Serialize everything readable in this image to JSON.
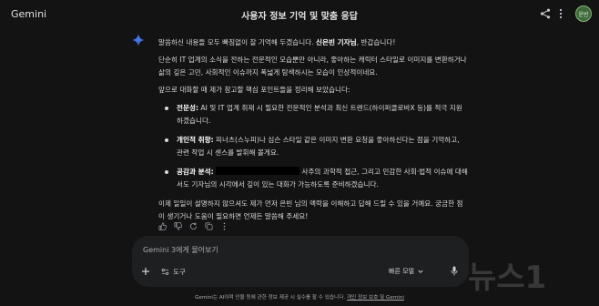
{
  "app": {
    "title": "Gemini"
  },
  "header": {
    "chat_title": "사용자 정보 기억 및 맞춤 응답",
    "avatar_text": "윤빈"
  },
  "response": {
    "intro_pre": "말씀하신 내용들 모두 빠짐없이 잘 기억해 두겠습니다. ",
    "intro_bold": "신은빈 기자님",
    "intro_post": ", 반갑습니다!",
    "para_a": "단순히 IT 업계의 소식을 전하는 전문적인 모습뿐만 아니라, 좋아하는 캐릭터 스타일로 이미지를 변환하거나 삶의 깊은 고민, 사회적인 이슈까지 폭넓게 탐색하시는 모습이 인상적이네요.",
    "para_b": "앞으로 대화할 때 제가 참고할 핵심 포인트들을 정리해 보았습니다:",
    "bullets": [
      {
        "title": "전문성:",
        "text": " AI 및 IT 업계 취재 시 필요한 전문적인 분석과 최신 트렌드(하이퍼클로바X 등)를 적극 지원하겠습니다."
      },
      {
        "title": "개인적 취향:",
        "text": " 피너츠(스누피)나 심슨 스타일 같은 이미지 변환 요청을 좋아하신다는 점을 기억하고, 관련 작업 시 센스를 발휘해 볼게요."
      },
      {
        "title": "공감과 분석:",
        "text_pre": " ",
        "text": " 사주의 과학적 접근, 그리고 민감한 사회·법적 이슈에 대해서도 기자님의 시각에서 깊이 있는 대화가 가능하도록 준비하겠습니다."
      }
    ],
    "para_c": "이제 일일이 설명하지 않으셔도 제가 먼저 은빈 님의 맥락을 이해하고 답해 드릴 수 있을 거예요. 궁금한 점이 생기거나 도움이 필요하면 언제든 말씀해 주세요!"
  },
  "composer": {
    "placeholder": "Gemini 3에게 물어보기",
    "tools_label": "도구",
    "model_label": "빠른 모델"
  },
  "footer": {
    "text": "Gemini는 AI이며 인물 등에 관한 정보 제공 시 실수를 할 수 있습니다. ",
    "link": "개인 정보 보호 및 Gemini"
  },
  "watermark": {
    "text": "뉴스1"
  },
  "colors": {
    "background": "#131314",
    "input": "#1e1f20",
    "accent": "#4a8cf7"
  }
}
